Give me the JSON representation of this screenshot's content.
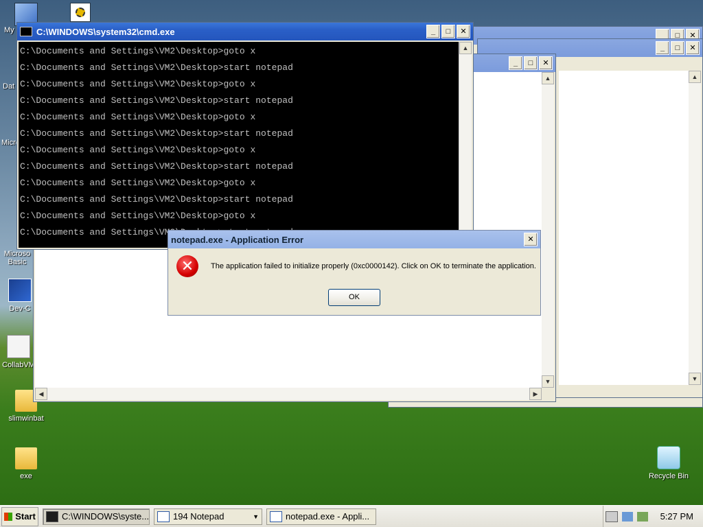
{
  "desktop": {
    "icons": [
      {
        "label": "My",
        "icon": "computer-icon"
      },
      {
        "label": "Dat",
        "icon": "database-icon"
      },
      {
        "label": "Micro",
        "icon": "app-icon"
      },
      {
        "label": "Microso Basic",
        "icon": "app-icon"
      },
      {
        "label": "Dev-C",
        "icon": "dev-icon"
      },
      {
        "label": "CollabVM",
        "icon": "collab-icon"
      },
      {
        "label": "slimwinbat",
        "icon": "folder-icon"
      },
      {
        "label": "exe",
        "icon": "folder-icon"
      },
      {
        "label": "Recycle Bin",
        "icon": "recycle-bin-icon"
      }
    ]
  },
  "cmd": {
    "title": "C:\\WINDOWS\\system32\\cmd.exe",
    "lines": [
      "C:\\Documents and Settings\\VM2\\Desktop>goto x",
      "C:\\Documents and Settings\\VM2\\Desktop>start notepad",
      "C:\\Documents and Settings\\VM2\\Desktop>goto x",
      "C:\\Documents and Settings\\VM2\\Desktop>start notepad",
      "C:\\Documents and Settings\\VM2\\Desktop>goto x",
      "C:\\Documents and Settings\\VM2\\Desktop>start notepad",
      "C:\\Documents and Settings\\VM2\\Desktop>goto x",
      "C:\\Documents and Settings\\VM2\\Desktop>start notepad",
      "C:\\Documents and Settings\\VM2\\Desktop>goto x",
      "C:\\Documents and Settings\\VM2\\Desktop>start notepad",
      "C:\\Documents and Settings\\VM2\\Desktop>goto x",
      "C:\\Documents and Settings\\VM2\\Desktop>start notepad"
    ]
  },
  "dialog": {
    "title": "notepad.exe - Application Error",
    "message": "The application failed to initialize properly (0xc0000142). Click on OK to terminate the application.",
    "ok_label": "OK"
  },
  "window_buttons": {
    "minimize": "_",
    "maximize": "□",
    "close": "✕"
  },
  "taskbar": {
    "start_label": "Start",
    "tasks": [
      {
        "label": "C:\\WINDOWS\\syste...",
        "icon": "cmd-icon"
      },
      {
        "label": "194 Notepad",
        "icon": "notepad-icon"
      },
      {
        "label": "notepad.exe - Appli...",
        "icon": "window-icon"
      }
    ],
    "clock": "5:27 PM"
  }
}
